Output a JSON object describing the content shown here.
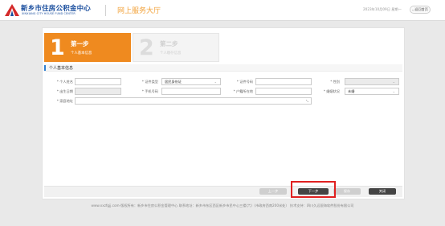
{
  "header": {
    "logo_cn": "新乡市住房公积金中心",
    "logo_en": "XINXIANG CITY HOUSE FUND CENTER",
    "site_title": "网上服务大厅",
    "date": "2023年10月09日 星期一",
    "back_label": "返回首页"
  },
  "steps": [
    {
      "num": "1",
      "title": "第一步",
      "sub": "个人基本信息",
      "active": true
    },
    {
      "num": "2",
      "title": "第二步",
      "sub": "个人缴存信息",
      "active": false
    }
  ],
  "section": {
    "title": "个人基本信息"
  },
  "form": {
    "name_label": "* 个人姓名",
    "id_type_label": "* 证件类型",
    "id_type_value": "居民身份证",
    "id_no_label": "* 证件号码",
    "gender_label": "* 性别",
    "birth_label": "* 出生日期",
    "phone_label": "* 手机号码",
    "hukou_label": "* 户籍所在地",
    "marital_label": "* 婚姻状况",
    "marital_value": "未婚",
    "address_label": "* 家庭地址"
  },
  "buttons": {
    "prev": "上一步",
    "next": "下一步",
    "save": "保存",
    "close": "关闭"
  },
  "footer": {
    "text": "www.xxzfgjj.com-版权所有：新乡市住房公积金管理中心 联系地址：新乡市东区西区新乡市民中心三楼(六)（市政府西南200米处） 技术支持：四川久远银海软件股份有限公司"
  },
  "colors": {
    "accent": "#ef8a1f",
    "brand": "#1a4e9e",
    "highlight": "#e02020"
  }
}
